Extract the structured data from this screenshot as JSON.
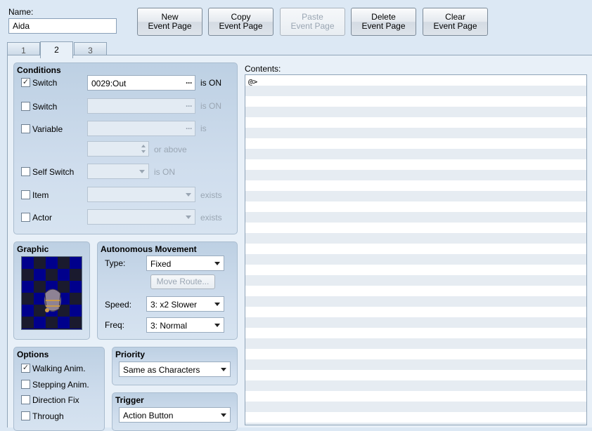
{
  "name": {
    "label": "Name:",
    "value": "Aida"
  },
  "toolbar": {
    "new_page": "New\nEvent Page",
    "copy_page": "Copy\nEvent Page",
    "paste_page": "Paste\nEvent Page",
    "delete_page": "Delete\nEvent Page",
    "clear_page": "Clear\nEvent Page"
  },
  "tabs": [
    "1",
    "2",
    "3"
  ],
  "conditions": {
    "title": "Conditions",
    "switch1": {
      "label": "Switch",
      "checked": "✓",
      "value": "0029:Out",
      "suffix": "is ON"
    },
    "switch2": {
      "label": "Switch",
      "value": "",
      "suffix": "is ON"
    },
    "variable": {
      "label": "Variable",
      "value": "",
      "suffix": "is",
      "number": "",
      "suffix2": "or above"
    },
    "self_switch": {
      "label": "Self Switch",
      "value": "",
      "suffix": "is ON"
    },
    "item": {
      "label": "Item",
      "value": "",
      "suffix": "exists"
    },
    "actor": {
      "label": "Actor",
      "value": "",
      "suffix": "exists"
    }
  },
  "graphic": {
    "title": "Graphic"
  },
  "movement": {
    "title": "Autonomous Movement",
    "type_label": "Type:",
    "type_value": "Fixed",
    "move_route": "Move Route...",
    "speed_label": "Speed:",
    "speed_value": "3: x2 Slower",
    "freq_label": "Freq:",
    "freq_value": "3: Normal"
  },
  "options": {
    "title": "Options",
    "walking": "Walking Anim.",
    "walking_checked": "✓",
    "stepping": "Stepping Anim.",
    "direction_fix": "Direction Fix",
    "through": "Through"
  },
  "priority": {
    "title": "Priority",
    "value": "Same as Characters"
  },
  "trigger": {
    "title": "Trigger",
    "value": "Action Button"
  },
  "contents": {
    "label": "Contents:",
    "lines": [
      "@>"
    ]
  }
}
